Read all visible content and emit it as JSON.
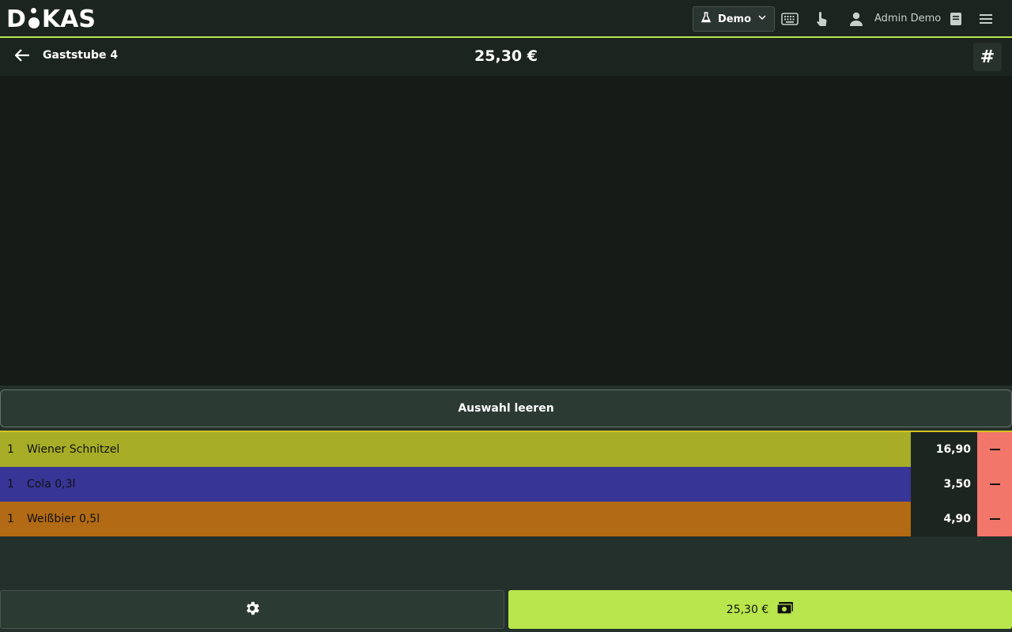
{
  "brand": {
    "logo_left": "D",
    "logo_right": "KAS",
    "accent_color": "#b8e64c"
  },
  "topbar": {
    "mode_select": {
      "label": "Demo",
      "icon": "flask-icon"
    },
    "icons": [
      "keyboard-icon",
      "touch-icon",
      "user-icon",
      "book-icon",
      "menu-icon"
    ],
    "user_name": "Admin Demo"
  },
  "subheader": {
    "table_name": "Gaststube 4",
    "total": "25,30 €",
    "hash_label": "#"
  },
  "order": {
    "clear_label": "Auswahl leeren",
    "items": [
      {
        "qty": "1",
        "name": "Wiener Schnitzel",
        "price": "16,90",
        "color": "#a7ad27"
      },
      {
        "qty": "1",
        "name": "Cola 0,3l",
        "price": "3,50",
        "color": "#373596"
      },
      {
        "qty": "1",
        "name": "Weißbier 0,5l",
        "price": "4,90",
        "color": "#b26a14"
      }
    ]
  },
  "footer": {
    "pay_label": "25,30 €",
    "pay_icon": "cash-icon",
    "settings_icon": "gear-icon"
  }
}
